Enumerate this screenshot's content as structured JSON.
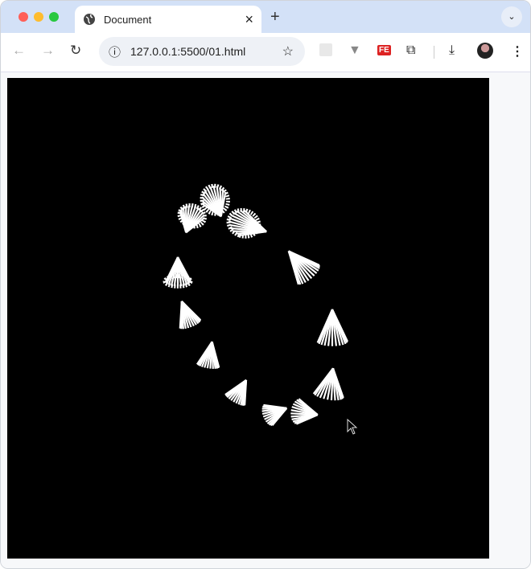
{
  "window": {
    "controls": {
      "close": "#ff5f57",
      "minimize": "#febc2e",
      "maximize": "#28c840"
    }
  },
  "tab": {
    "title": "Document",
    "close_icon": "×",
    "new_tab_icon": "+",
    "tab_menu_icon": "⌄"
  },
  "toolbar": {
    "back": "←",
    "forward": "→",
    "reload": "↻",
    "url": "127.0.0.1:5500/01.html",
    "info_icon": "ⓘ",
    "bookmark_icon": "☆",
    "download_icon": "⤓",
    "menu_icon": "⋮",
    "ext_fe": "FE"
  },
  "scene": {
    "cone_count": 12,
    "background": "#000000",
    "stripe_color": "#ffffff"
  }
}
